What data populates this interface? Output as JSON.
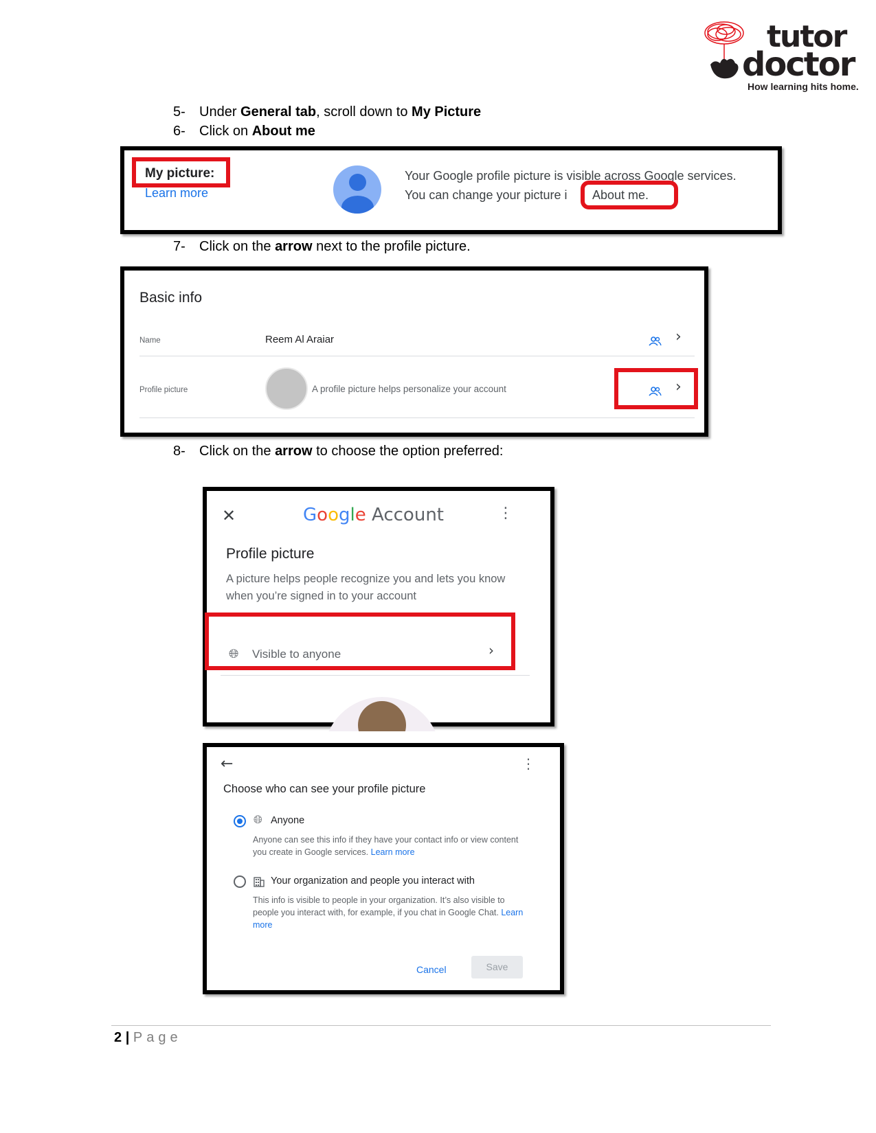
{
  "logo": {
    "word1": "tutor",
    "word2": "doctor",
    "tagline": "How learning hits home."
  },
  "steps": [
    {
      "num": "5-",
      "parts": [
        "Under ",
        "General tab",
        ", scroll down to ",
        "My Picture"
      ]
    },
    {
      "num": "6-",
      "parts": [
        "Click on ",
        "About me"
      ]
    },
    {
      "num": "7-",
      "parts": [
        "Click on the ",
        "arrow",
        " next to the profile picture."
      ]
    },
    {
      "num": "8-",
      "parts": [
        "Click on the ",
        "arrow",
        " to choose the option preferred:"
      ]
    }
  ],
  "my_picture_panel": {
    "label": "My picture:",
    "learn_more": "Learn more",
    "line1": "Your Google profile picture is visible across Google services.",
    "line2_prefix": "You can change your picture i",
    "about_me": "About me."
  },
  "basic_info_panel": {
    "title": "Basic info",
    "rows": [
      {
        "label": "Name",
        "value": "Reem Al Araiar"
      },
      {
        "label": "Profile picture",
        "value": "A profile picture helps personalize your account"
      }
    ],
    "chevron": "›"
  },
  "google_account_panel": {
    "close": "✕",
    "brand_letters": [
      "G",
      "o",
      "o",
      "g",
      "l",
      "e"
    ],
    "brand_colors": [
      "#4285F4",
      "#EA4335",
      "#FBBC05",
      "#4285F4",
      "#34A853",
      "#EA4335"
    ],
    "account_word": "Account",
    "title": "Profile picture",
    "description": "A picture helps people recognize you and lets you know when you’re signed in to your account",
    "visibility_option": "Visible to anyone",
    "chevron": "›"
  },
  "visibility_panel": {
    "back": "←",
    "title": "Choose who can see your profile picture",
    "options": [
      {
        "label": "Anyone",
        "selected": true,
        "icon": "globe-icon",
        "desc": "Anyone can see this info if they have your contact info or view content you create in Google services.",
        "learn_more": "Learn more"
      },
      {
        "label": "Your organization and people you interact with",
        "selected": false,
        "icon": "building-icon",
        "desc": "This info is visible to people in your organization. It’s also visible to people you interact with, for example, if you chat in Google Chat.",
        "learn_more": "Learn more"
      }
    ],
    "cancel": "Cancel",
    "save": "Save"
  },
  "footer": {
    "page_number": "2",
    "separator": "|",
    "page_word": "Page"
  },
  "colors": {
    "highlight_red": "#e3131b",
    "link_blue": "#1a73e8"
  }
}
